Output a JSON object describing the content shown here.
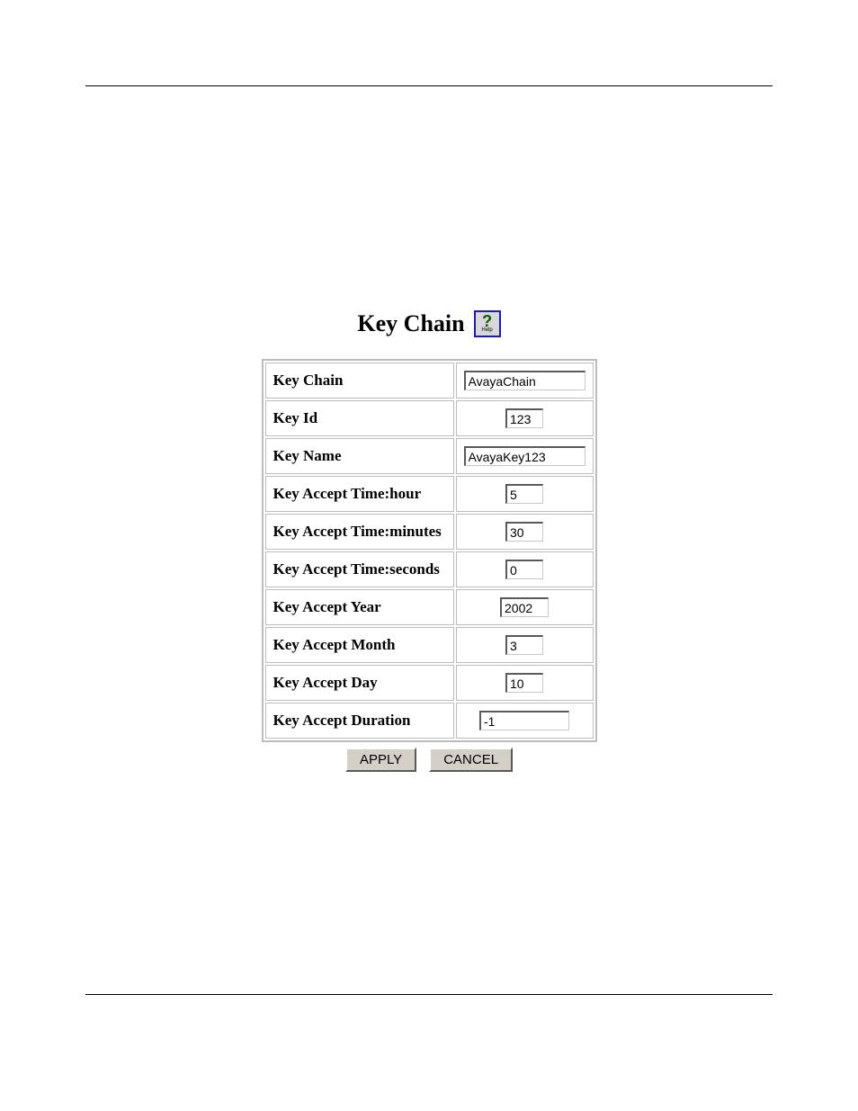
{
  "header": {
    "title": "Key Chain",
    "help_icon": "help-icon",
    "help_q": "?",
    "help_label": "Help"
  },
  "form": {
    "rows": [
      {
        "label": "Key Chain",
        "value": "AvayaChain",
        "cls": "w-wide"
      },
      {
        "label": "Key Id",
        "value": "123",
        "cls": "w-small"
      },
      {
        "label": "Key Name",
        "value": "AvayaKey123",
        "cls": "w-wide"
      },
      {
        "label": "Key Accept Time:hour",
        "value": "5",
        "cls": "w-small"
      },
      {
        "label": "Key Accept Time:minutes",
        "value": "30",
        "cls": "w-small"
      },
      {
        "label": "Key Accept Time:seconds",
        "value": "0",
        "cls": "w-small"
      },
      {
        "label": "Key Accept Year",
        "value": "2002",
        "cls": "w-med"
      },
      {
        "label": "Key Accept Month",
        "value": "3",
        "cls": "w-small"
      },
      {
        "label": "Key Accept Day",
        "value": "10",
        "cls": "w-small"
      },
      {
        "label": "Key Accept Duration",
        "value": "-1",
        "cls": "w-dur"
      }
    ]
  },
  "buttons": {
    "apply": "APPLY",
    "cancel": "CANCEL"
  }
}
